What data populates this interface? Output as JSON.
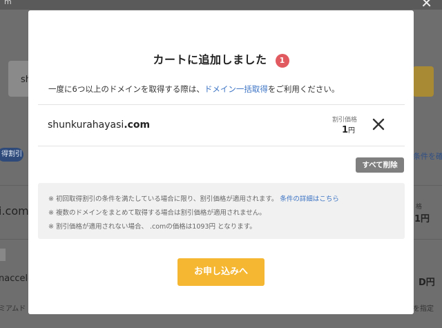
{
  "background": {
    "topbar_text": "m",
    "card_text": "sh",
    "badge": "得割引",
    "right_link": "条件を確",
    "domain": "i.com",
    "right_price_label": "格",
    "right_price": "1円",
    "domain2": "nacceler",
    "right_value": "D円",
    "bottom_left": "ミアムド",
    "bottom_right": "を指定"
  },
  "modal": {
    "title": "カートに追加しました",
    "cart_count": "1",
    "notice_before": "一度に6つ以上のドメインを取得する際は、",
    "notice_link": "ドメイン一括取得",
    "notice_after": "をご利用ください。",
    "items": [
      {
        "domain_name": "shunkurahayasi",
        "domain_tld": ".com",
        "price_label": "割引価格",
        "price_value": "1",
        "price_unit": "円"
      }
    ],
    "delete_all_label": "すべて削除",
    "terms": {
      "line1_text": "※ 初回取得割引の条件を満たしている場合に限り、割引価格が適用されます。",
      "line1_link": "条件の詳細はこちら",
      "line2_text": "※ 複数のドメインをまとめて取得する場合は割引価格が適用されません。",
      "line3_text": "※ 割引価格が適用されない場合、 .comの価格は1093円 となります。"
    },
    "apply_label": "お申し込みへ"
  },
  "icons": {
    "remove": "close-icon",
    "window_close": "close-icon"
  },
  "colors": {
    "badge_red": "#e15a5f",
    "link_blue": "#3b73c4",
    "apply_yellow": "#f5b731",
    "delete_gray": "#7f7f7f"
  }
}
